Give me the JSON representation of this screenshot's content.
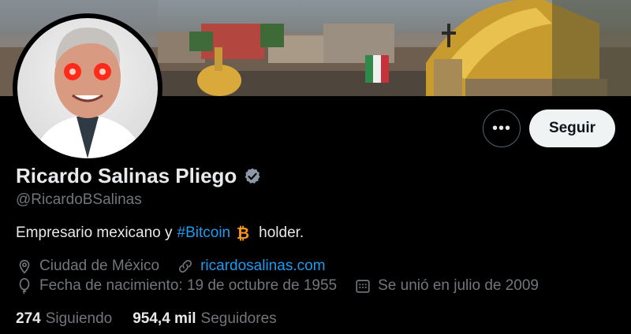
{
  "profile": {
    "name": "Ricardo Salinas Pliego",
    "handle": "@RicardoBSalinas",
    "bio_prefix": "Empresario mexicano y",
    "bio_hashtag": "#Bitcoin",
    "bio_suffix": "holder.",
    "location": "Ciudad de México",
    "website": "ricardosalinas.com",
    "birthdate": "Fecha de nacimiento: 19 de octubre de 1955",
    "joined": "Se unió en julio de 2009"
  },
  "stats": {
    "following_count": "274",
    "following_label": "Siguiendo",
    "followers_count": "954,4 mil",
    "followers_label": "Seguidores"
  },
  "actions": {
    "more_label": "•••",
    "follow_label": "Seguir"
  },
  "colors": {
    "background": "#000000",
    "link": "#1d9bf0",
    "muted": "#71767b",
    "bitcoin": "#f7931a"
  },
  "icons": {
    "more": "more-dots-icon",
    "verified": "verified-badge-icon",
    "bitcoin": "bitcoin-icon",
    "location": "location-pin-icon",
    "link": "link-icon",
    "birthday": "balloon-icon",
    "calendar": "calendar-icon"
  }
}
